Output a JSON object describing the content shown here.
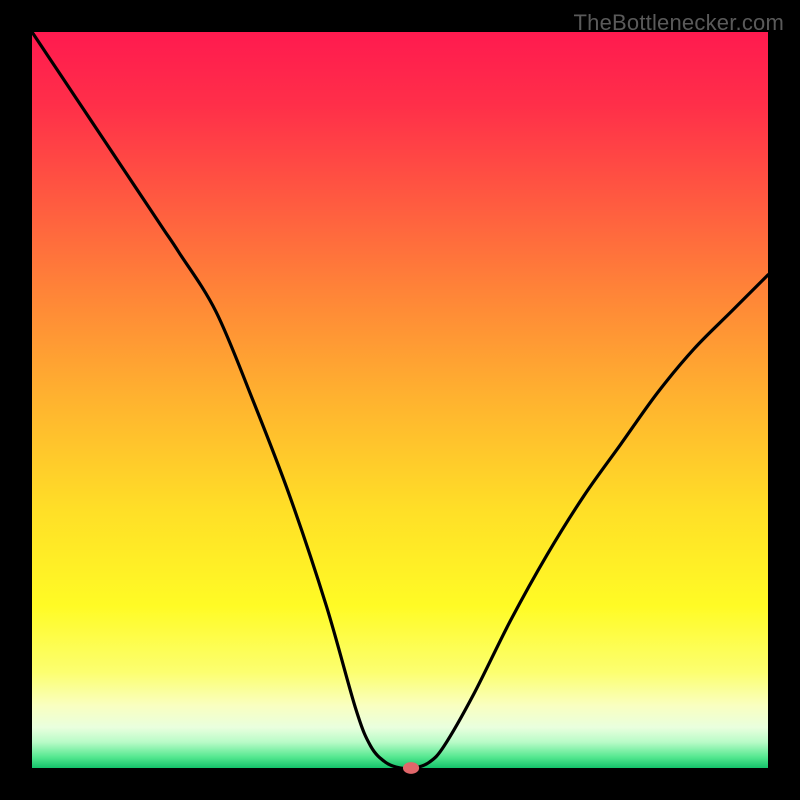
{
  "watermark": "TheBottlenecker.com",
  "chart_data": {
    "type": "line",
    "title": "",
    "xlabel": "",
    "ylabel": "",
    "xlim": [
      0,
      100
    ],
    "ylim": [
      0,
      100
    ],
    "grid": false,
    "legend": false,
    "x": [
      0,
      2,
      4,
      6,
      8,
      10,
      12,
      14,
      16,
      18,
      20,
      25,
      30,
      35,
      40,
      44,
      46,
      48,
      50,
      52,
      54,
      56,
      60,
      65,
      70,
      75,
      80,
      85,
      90,
      95,
      100
    ],
    "y": [
      100,
      97,
      94,
      91,
      88,
      85,
      82,
      79,
      76,
      73,
      70,
      62,
      50,
      37,
      22,
      8,
      3,
      0.8,
      0,
      0,
      0.8,
      3,
      10,
      20,
      29,
      37,
      44,
      51,
      57,
      62,
      67
    ],
    "marker": {
      "x": 51.5,
      "y": 0,
      "rx": 1.1,
      "ry": 0.8,
      "color": "#e0666a"
    },
    "background_gradient": [
      {
        "offset": 0.0,
        "color": "#ff1a4f"
      },
      {
        "offset": 0.1,
        "color": "#ff2f49"
      },
      {
        "offset": 0.22,
        "color": "#ff5741"
      },
      {
        "offset": 0.35,
        "color": "#ff8338"
      },
      {
        "offset": 0.5,
        "color": "#ffb32f"
      },
      {
        "offset": 0.65,
        "color": "#ffdf27"
      },
      {
        "offset": 0.78,
        "color": "#fffb25"
      },
      {
        "offset": 0.87,
        "color": "#fcff70"
      },
      {
        "offset": 0.915,
        "color": "#f9ffc0"
      },
      {
        "offset": 0.945,
        "color": "#e9ffde"
      },
      {
        "offset": 0.965,
        "color": "#b8fbc7"
      },
      {
        "offset": 0.985,
        "color": "#55e890"
      },
      {
        "offset": 1.0,
        "color": "#14c26a"
      }
    ]
  }
}
